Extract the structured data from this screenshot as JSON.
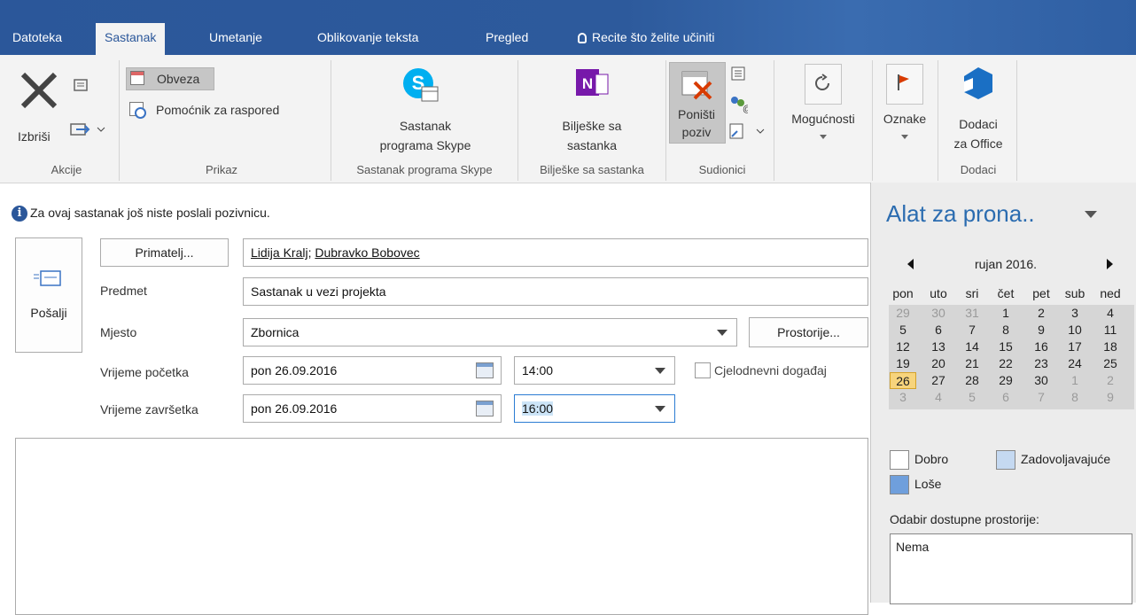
{
  "tabs": [
    {
      "label": "Datoteka"
    },
    {
      "label": "Sastanak"
    },
    {
      "label": "Umetanje"
    },
    {
      "label": "Oblikovanje teksta"
    },
    {
      "label": "Pregled"
    },
    {
      "label": "Recite što želite učiniti"
    }
  ],
  "ribbon": {
    "akcije": {
      "delete_label": "Izbriši",
      "group": "Akcije"
    },
    "prikaz": {
      "obveza": "Obveza",
      "pomocnik": "Pomoćnik za raspored",
      "group": "Prikaz"
    },
    "skype": {
      "line1": "Sastanak",
      "line2": "programa Skype",
      "group": "Sastanak programa Skype"
    },
    "biljeske": {
      "line1": "Bilješke sa",
      "line2": "sastanka",
      "group": "Bilješke sa sastanka"
    },
    "sudionici": {
      "line1": "Poništi",
      "line2": "poziv",
      "group": "Sudionici"
    },
    "mogucnosti": {
      "label": "Mogućnosti"
    },
    "oznake": {
      "label": "Oznake"
    },
    "dodaci": {
      "line1": "Dodaci",
      "line2": "za Office",
      "group": "Dodaci"
    }
  },
  "info": {
    "message": "Za ovaj sastanak još niste poslali pozivnicu."
  },
  "form": {
    "send_label": "Pošalji",
    "to_button": "Primatelj...",
    "recipients": [
      {
        "name": "Lidija Kralj"
      },
      {
        "name": "Dubravko Bobovec"
      }
    ],
    "recipient_sep": "; ",
    "subject_label": "Predmet",
    "subject": "Sastanak u vezi projekta",
    "location_label": "Mjesto",
    "location": "Zbornica",
    "rooms_button": "Prostorije...",
    "start_label": "Vrijeme početka",
    "start_date": "pon 26.09.2016",
    "start_time": "14:00",
    "allday_label": "Cjelodnevni događaj",
    "end_label": "Vrijeme završetka",
    "end_date": "pon 26.09.2016",
    "end_time": "16:00"
  },
  "finder": {
    "title": "Alat za prona..",
    "month": "rujan 2016.",
    "weekdays": [
      "pon",
      "uto",
      "sri",
      "čet",
      "pet",
      "sub",
      "ned"
    ],
    "weeks": [
      [
        "29",
        "30",
        "31",
        "1",
        "2",
        "3",
        "4"
      ],
      [
        "5",
        "6",
        "7",
        "8",
        "9",
        "10",
        "11"
      ],
      [
        "12",
        "13",
        "14",
        "15",
        "16",
        "17",
        "18"
      ],
      [
        "19",
        "20",
        "21",
        "22",
        "23",
        "24",
        "25"
      ],
      [
        "26",
        "27",
        "28",
        "29",
        "30",
        "1",
        "2"
      ],
      [
        "3",
        "4",
        "5",
        "6",
        "7",
        "8",
        "9"
      ]
    ],
    "legend_good": "Dobro",
    "legend_fair": "Zadovoljavajuće",
    "legend_poor": "Loše",
    "rooms_label": "Odabir dostupne prostorije:",
    "rooms_value": "Nema",
    "colors": {
      "fair": "#c5d9f1",
      "poor": "#6f9fdc",
      "selected": "#f7d47c"
    }
  }
}
